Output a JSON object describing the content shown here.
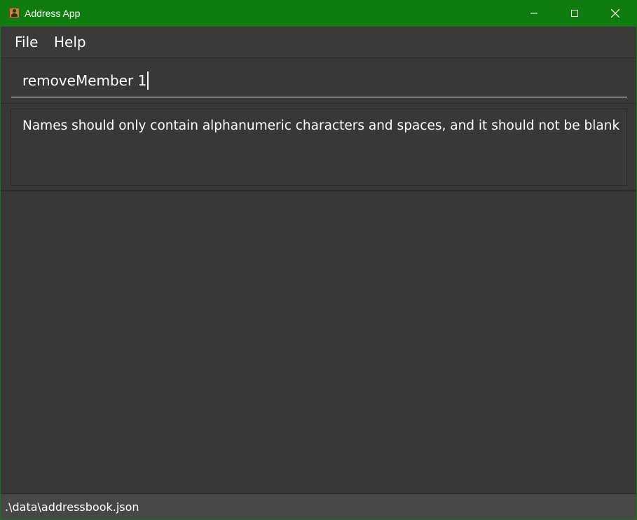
{
  "window": {
    "title": "Address App",
    "icon": "address-book-icon",
    "controls": [
      "minimize-icon",
      "maximize-icon",
      "close-icon"
    ],
    "accent_color": "#107c10"
  },
  "menubar": {
    "file_label": "File",
    "help_label": "Help"
  },
  "command_box": {
    "value": "removeMember 1"
  },
  "result_display": {
    "message": "Names should only contain alphanumeric characters and spaces, and it should not be blank"
  },
  "status_bar": {
    "file_path": ".\\data\\addressbook.json"
  }
}
